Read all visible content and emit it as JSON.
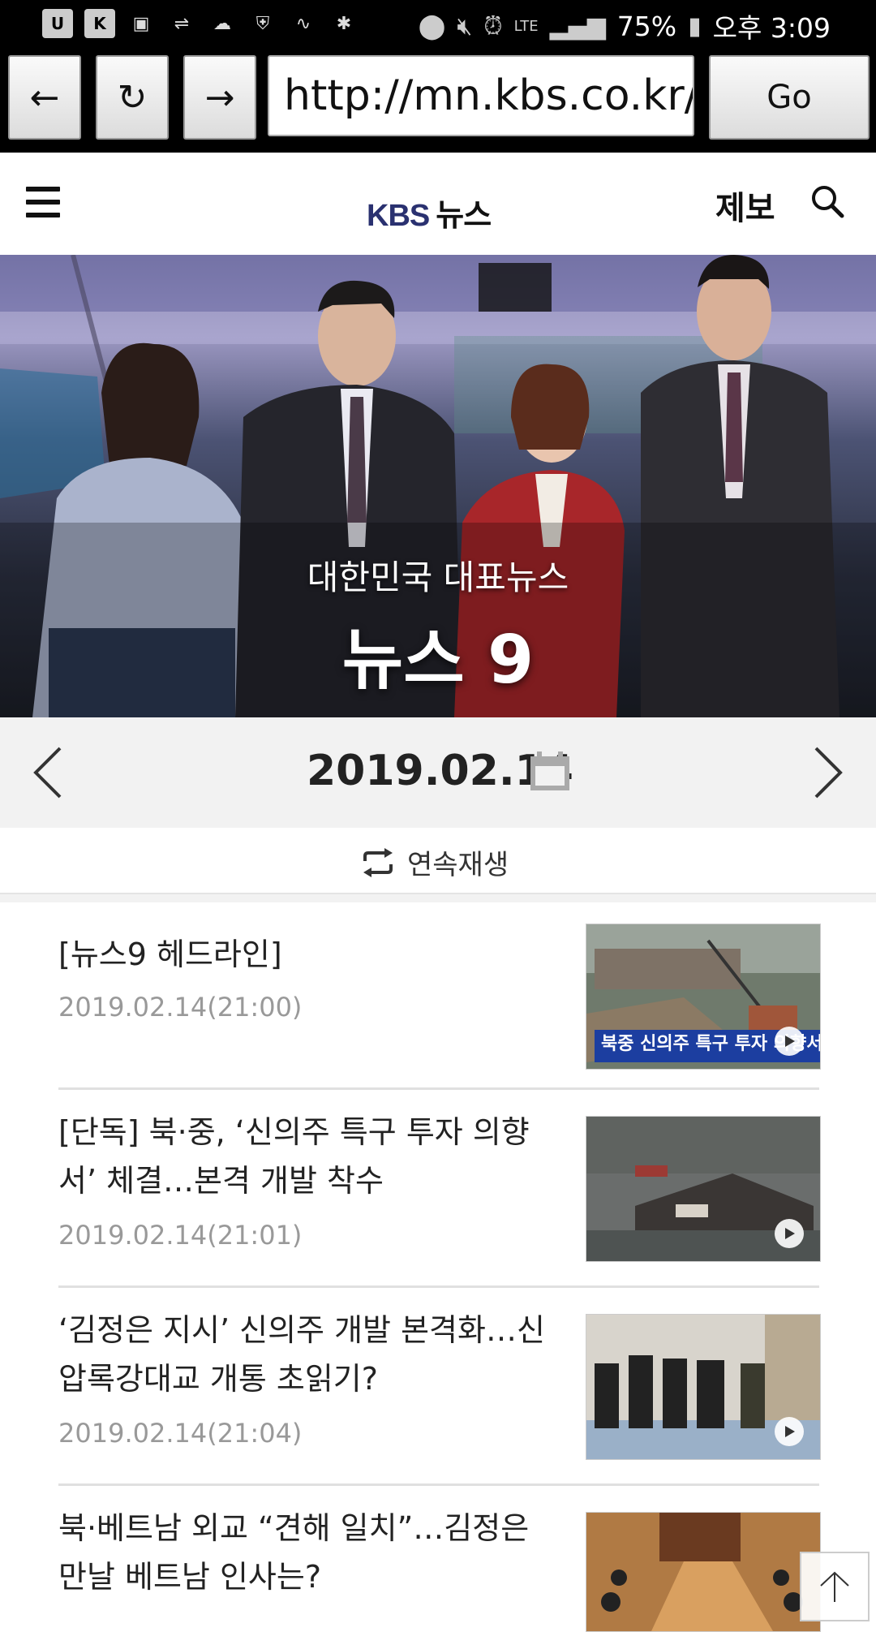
{
  "status_bar": {
    "left_icons": [
      "u-plus-icon",
      "k-icon",
      "image-icon",
      "usb-icon",
      "sync-icon",
      "en-shield-icon",
      "activity-icon",
      "bug-icon"
    ],
    "battery": "75%",
    "time": "오후 3:09",
    "network": "LTE"
  },
  "browser": {
    "back_label": "←",
    "reload_label": "↻",
    "forward_label": "→",
    "url": "http://mn.kbs.co.kr/n",
    "go_label": "Go"
  },
  "header": {
    "logo_brand": "KBS",
    "logo_text": "뉴스",
    "report_label": "제보"
  },
  "hero": {
    "subtitle": "대한민국 대표뉴스",
    "title": "뉴스 9"
  },
  "date_nav": {
    "date": "2019.02.14"
  },
  "autoplay": {
    "label": "연속재생"
  },
  "news": [
    {
      "title": "[뉴스9 헤드라인]",
      "date": "2019.02.14(21:00)",
      "thumb_caption": "북중 신의주 특구 투자 의향서 체결 확인"
    },
    {
      "title": "[단독] 북·중, ‘신의주 특구 투자 의향서’ 체결…본격 개발 착수",
      "date": "2019.02.14(21:01)"
    },
    {
      "title": "‘김정은 지시’ 신의주 개발 본격화…신압록강대교 개통 초읽기?",
      "date": "2019.02.14(21:04)"
    },
    {
      "title": "북·베트남 외교 “견해 일치”…김정은 만날 베트남 인사는?",
      "date": ""
    }
  ],
  "colors": {
    "logo_navy": "#2a3170",
    "date_bar_bg": "#f2f2f2",
    "caption_blue": "#1c3ea0"
  }
}
